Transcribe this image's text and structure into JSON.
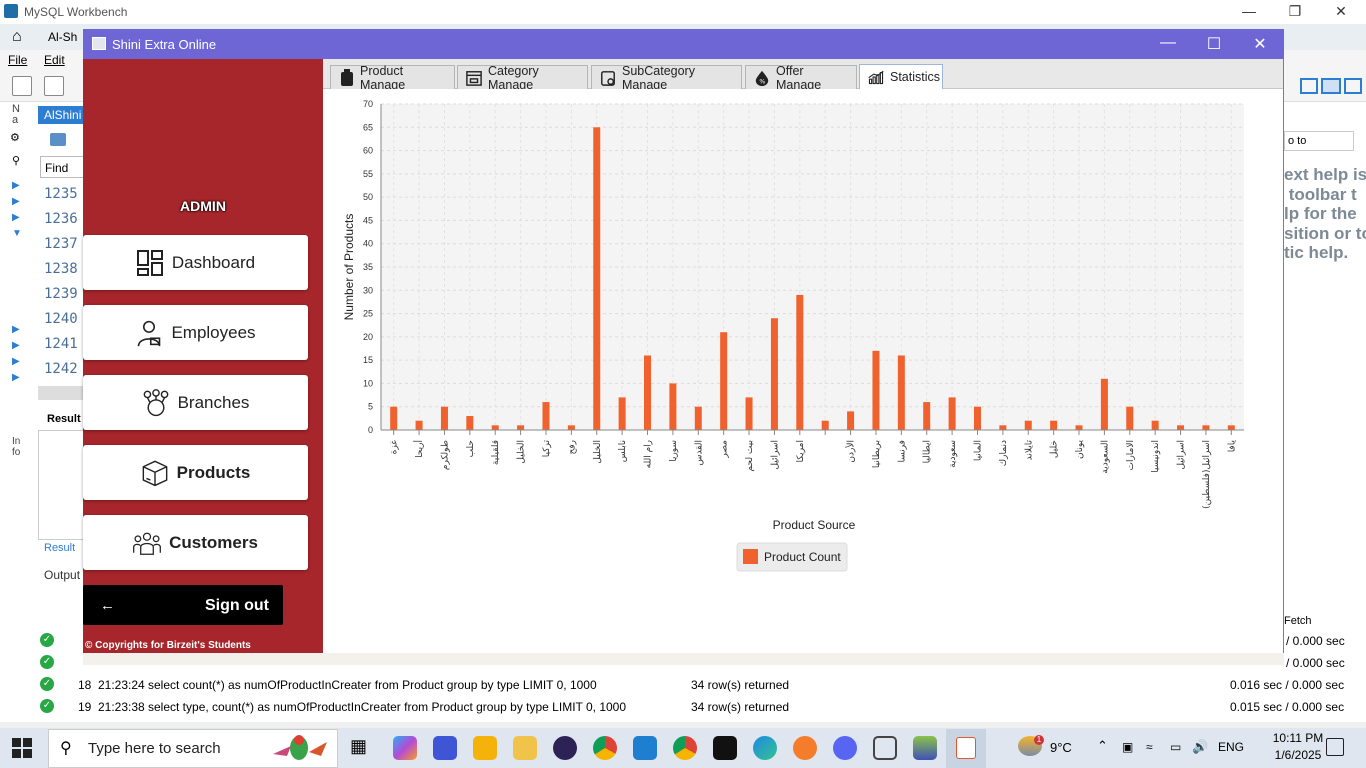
{
  "workbench": {
    "title": "MySQL Workbench",
    "tab_label": "Al-Sh",
    "menu": [
      "File",
      "Edit"
    ],
    "schema_tab": "AlShini",
    "find_placeholder": "Find",
    "line_numbers": [
      "1235",
      "1236",
      "1237",
      "1238",
      "1239",
      "1240",
      "1241",
      "1242"
    ],
    "result_label": "Result",
    "output_label": "Output",
    "help_text": "ext help is\n toolbar t\nlp for the\nsition or to\ntic help.",
    "right_input": "o to",
    "fetch_header": "Fetch",
    "output_rows": [
      {
        "num": "",
        "time": "",
        "action": "",
        "message": "",
        "duration": "/ 0.000 sec"
      },
      {
        "num": "",
        "time": "",
        "action": "",
        "message": "",
        "duration": "/ 0.000 sec"
      },
      {
        "num": "18",
        "time": "21:23:24",
        "action": "select count(*) as numOfProductInCreater from Product group by type LIMIT 0, 1000",
        "message": "34 row(s) returned",
        "duration": "0.016 sec / 0.000 sec"
      },
      {
        "num": "19",
        "time": "21:23:38",
        "action": "select type, count(*) as numOfProductInCreater from Product group by type LIMIT 0, 1000",
        "message": "34 row(s) returned",
        "duration": "0.015 sec / 0.000 sec"
      }
    ]
  },
  "app": {
    "title": "Shini Extra Online",
    "role": "ADMIN",
    "nav": [
      {
        "label": "Dashboard",
        "icon": "dashboard-icon"
      },
      {
        "label": "Employees",
        "icon": "employee-icon"
      },
      {
        "label": "Branches",
        "icon": "branches-icon"
      },
      {
        "label": "Products",
        "icon": "box-icon"
      },
      {
        "label": "Customers",
        "icon": "customers-icon"
      }
    ],
    "signout_arrow": "←",
    "signout_label": "Sign out",
    "copyright": "© Copyrights for Birzeit's Students",
    "tabs": [
      {
        "label": "Product Manage",
        "icon": "product-icon"
      },
      {
        "label": "Category Manage",
        "icon": "category-icon"
      },
      {
        "label": "SubCategory Manage",
        "icon": "subcategory-icon"
      },
      {
        "label": "Offer Manage",
        "icon": "offer-icon"
      },
      {
        "label": "Statistics",
        "icon": "statistics-icon"
      }
    ],
    "active_tab": "Statistics",
    "colors": {
      "sidebar": "#a6262b",
      "titlebar": "#6f66d6",
      "bar": "#f0612d"
    }
  },
  "chart_data": {
    "type": "bar",
    "title": "",
    "xlabel": "Product Source",
    "ylabel": "Number of Products",
    "ylim": [
      0,
      70
    ],
    "yticks": [
      0,
      5,
      10,
      15,
      20,
      25,
      30,
      35,
      40,
      45,
      50,
      55,
      60,
      65,
      70
    ],
    "grid": true,
    "legend_position": "bottom-center",
    "categories": [
      "غزة",
      "أريحا",
      "طولكرم",
      "حلب",
      "قلقيلية",
      "الخليل",
      "تركيا",
      "رفح",
      "الخليل",
      "نابلس",
      "رام الله",
      "سوريا",
      "القدس",
      "مصر",
      "بيت لحم",
      "اسرائيل",
      "امريكا",
      "",
      "الأردن",
      "بريطانيا",
      "فرنسا",
      "ايطاليا",
      "سعودية",
      "المانيا",
      "دنمارك",
      "تايلاند",
      "خليل",
      "يونان",
      "السعودية",
      "الامارات",
      "اندونيسيا",
      "اسرائيل",
      "اسرائيل(فلسطين)",
      "يافا"
    ],
    "series": [
      {
        "name": "Product Count",
        "color": "#f0612d",
        "values": [
          5,
          2,
          5,
          3,
          1,
          1,
          6,
          1,
          65,
          7,
          16,
          10,
          5,
          21,
          7,
          24,
          29,
          2,
          4,
          17,
          16,
          6,
          7,
          5,
          1,
          2,
          2,
          1,
          11,
          5,
          2,
          1,
          1,
          1
        ]
      }
    ]
  },
  "taskbar": {
    "search_placeholder": "Type here to search",
    "weather": "9°C",
    "weather_badge": "1",
    "language": "ENG",
    "time": "10:11 PM",
    "date": "1/6/2025"
  }
}
